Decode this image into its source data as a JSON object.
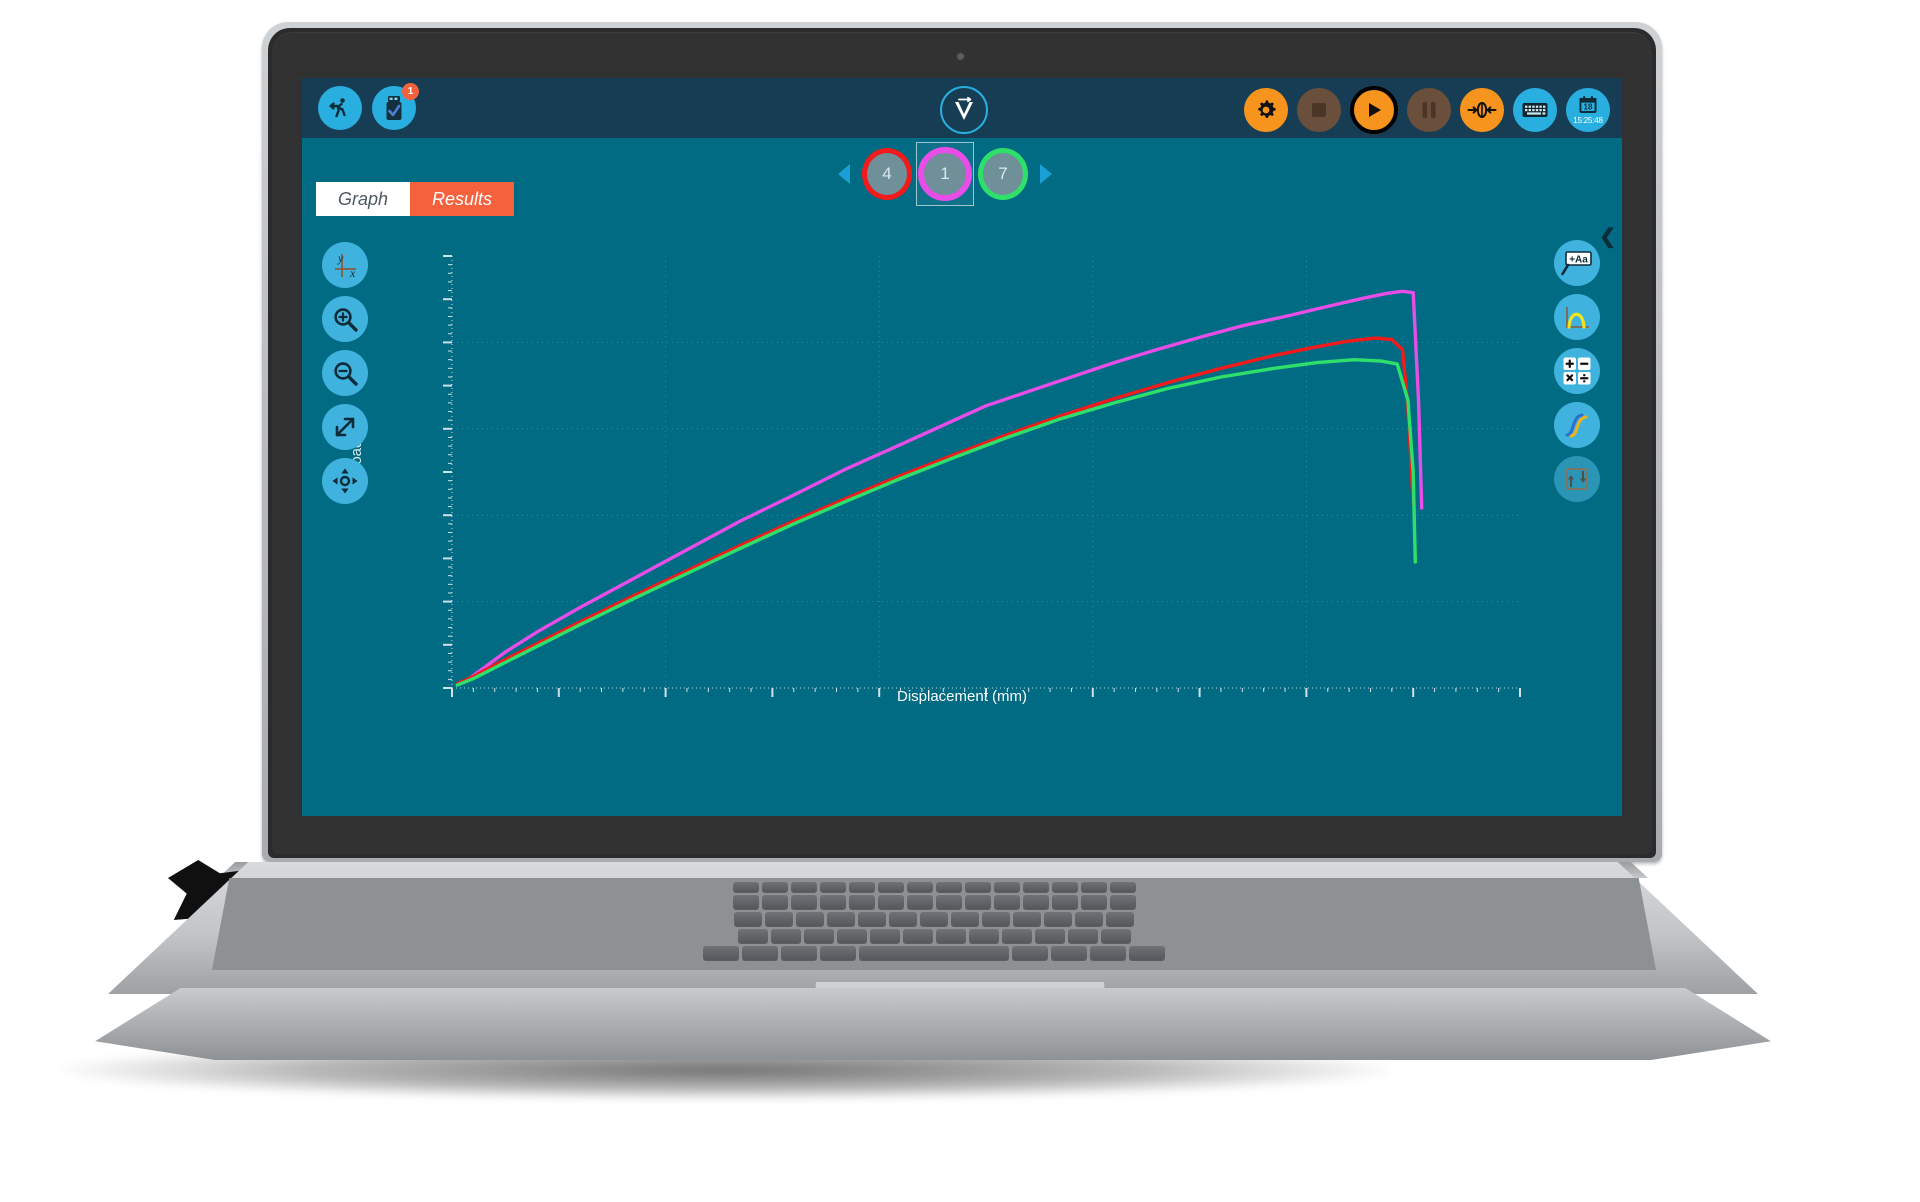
{
  "app": {
    "logo_name": "vernier-v-logo",
    "topbar": {
      "left_buttons": [
        {
          "name": "sensor-run-icon",
          "label": "Run"
        },
        {
          "name": "usb-device-icon",
          "label": "Device",
          "badge": "1"
        }
      ],
      "right_buttons": [
        {
          "name": "gear-icon",
          "label": "Settings",
          "style": "orange"
        },
        {
          "name": "stop-icon",
          "label": "Stop",
          "style": "dim"
        },
        {
          "name": "play-icon",
          "label": "Start",
          "style": "record"
        },
        {
          "name": "pause-icon",
          "label": "Pause",
          "style": "dim"
        },
        {
          "name": "zero-icon",
          "label": "Zero",
          "style": "orange"
        },
        {
          "name": "keyboard-icon",
          "label": "Keyboard",
          "style": "cyan"
        }
      ],
      "clock": {
        "day": "18",
        "time": "15:25:48"
      }
    },
    "sample_nav": {
      "prev_label": "Previous sample",
      "next_label": "Next sample",
      "samples": [
        {
          "number": "4",
          "ring_color": "#f21a1a",
          "selected": false
        },
        {
          "number": "1",
          "ring_color": "#e84de8",
          "selected": true
        },
        {
          "number": "7",
          "ring_color": "#2ee06a",
          "selected": false
        }
      ]
    },
    "tabs": [
      {
        "label": "Graph",
        "active": true
      },
      {
        "label": "Results",
        "active": false
      }
    ],
    "left_tools": [
      {
        "name": "axis-settings-icon",
        "label": "Axis options"
      },
      {
        "name": "zoom-in-icon",
        "label": "Zoom in"
      },
      {
        "name": "zoom-out-icon",
        "label": "Zoom out"
      },
      {
        "name": "fit-expand-icon",
        "label": "Zoom to fit"
      },
      {
        "name": "pan-icon",
        "label": "Pan"
      }
    ],
    "right_tools": [
      {
        "name": "add-annotation-icon",
        "label": "Add annotation"
      },
      {
        "name": "peak-curve-icon",
        "label": "Curve fit"
      },
      {
        "name": "calculator-icon",
        "label": "Calculations"
      },
      {
        "name": "smooth-curve-icon",
        "label": "Smooth data"
      },
      {
        "name": "axis-swap-icon",
        "label": "Swap axes"
      }
    ],
    "collapse_label": "Collapse panel"
  },
  "chart_data": {
    "type": "line",
    "title": "",
    "xlabel": "Displacement (mm)",
    "ylabel": "Load (N)",
    "xlim": [
      0,
      10
    ],
    "ylim": [
      0,
      600
    ],
    "grid": true,
    "legend": "none",
    "series": [
      {
        "name": "Sample 1",
        "color": "#e84de8",
        "x": [
          0.05,
          0.15,
          0.3,
          0.5,
          0.8,
          1.2,
          1.7,
          2.2,
          2.7,
          3.2,
          3.7,
          4.2,
          4.6,
          5.0,
          5.4,
          5.8,
          6.2,
          6.6,
          7.0,
          7.4,
          7.8,
          8.2,
          8.55,
          8.75,
          8.9,
          9.0,
          9.05,
          9.08
        ],
        "y": [
          5,
          12,
          28,
          50,
          78,
          112,
          152,
          192,
          232,
          268,
          305,
          338,
          365,
          392,
          412,
          432,
          452,
          470,
          487,
          503,
          516,
          530,
          542,
          548,
          551,
          549,
          400,
          250
        ]
      },
      {
        "name": "Sample 4",
        "color": "#f21a1a",
        "x": [
          0.05,
          0.2,
          0.45,
          0.8,
          1.2,
          1.7,
          2.2,
          2.7,
          3.2,
          3.7,
          4.2,
          4.7,
          5.2,
          5.7,
          6.2,
          6.7,
          7.2,
          7.7,
          8.1,
          8.4,
          8.65,
          8.8,
          8.9,
          8.95,
          9.0
        ],
        "y": [
          6,
          16,
          36,
          62,
          92,
          128,
          163,
          198,
          232,
          264,
          295,
          324,
          352,
          378,
          402,
          424,
          444,
          462,
          474,
          482,
          486,
          484,
          470,
          390,
          255
        ]
      },
      {
        "name": "Sample 7",
        "color": "#2ee06a",
        "x": [
          0.05,
          0.2,
          0.45,
          0.8,
          1.2,
          1.7,
          2.2,
          2.7,
          3.2,
          3.7,
          4.2,
          4.7,
          5.2,
          5.7,
          6.2,
          6.7,
          7.2,
          7.7,
          8.1,
          8.45,
          8.7,
          8.85,
          8.95,
          9.0,
          9.02
        ],
        "y": [
          4,
          13,
          32,
          58,
          88,
          124,
          159,
          194,
          228,
          260,
          291,
          320,
          348,
          374,
          396,
          416,
          432,
          444,
          452,
          456,
          454,
          450,
          400,
          300,
          175
        ]
      }
    ]
  }
}
